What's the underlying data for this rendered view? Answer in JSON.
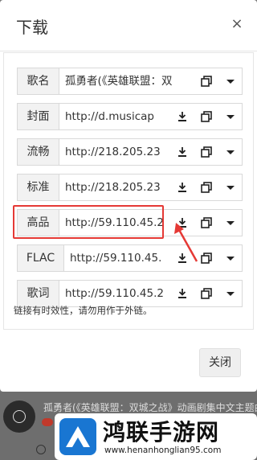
{
  "dialog": {
    "title": "下载",
    "close_symbol": "×",
    "hint": "链接有时效性，请勿用作于外链。",
    "close_button_label": "关闭"
  },
  "rows": [
    {
      "label": "歌名",
      "value": "孤勇者(《英雄联盟：双"
    },
    {
      "label": "封面",
      "value": "http://d.musicap"
    },
    {
      "label": "流畅",
      "value": "http://218.205.23"
    },
    {
      "label": "标准",
      "value": "http://218.205.23"
    },
    {
      "label": "高品",
      "value": "http://59.110.45.2"
    },
    {
      "label": "FLAC",
      "value": "http://59.110.45."
    },
    {
      "label": "歌词",
      "value": "http://59.110.45.2"
    }
  ],
  "background": {
    "song_text": "孤勇者(《英雄联盟：双城之战》动画剧集中文主题曲)"
  },
  "watermark": {
    "title": "鸿联手游网",
    "url": "www.henanhonglian95.com"
  },
  "colors": {
    "highlight": "#e53935",
    "watermark_blue": "#1976d2"
  }
}
